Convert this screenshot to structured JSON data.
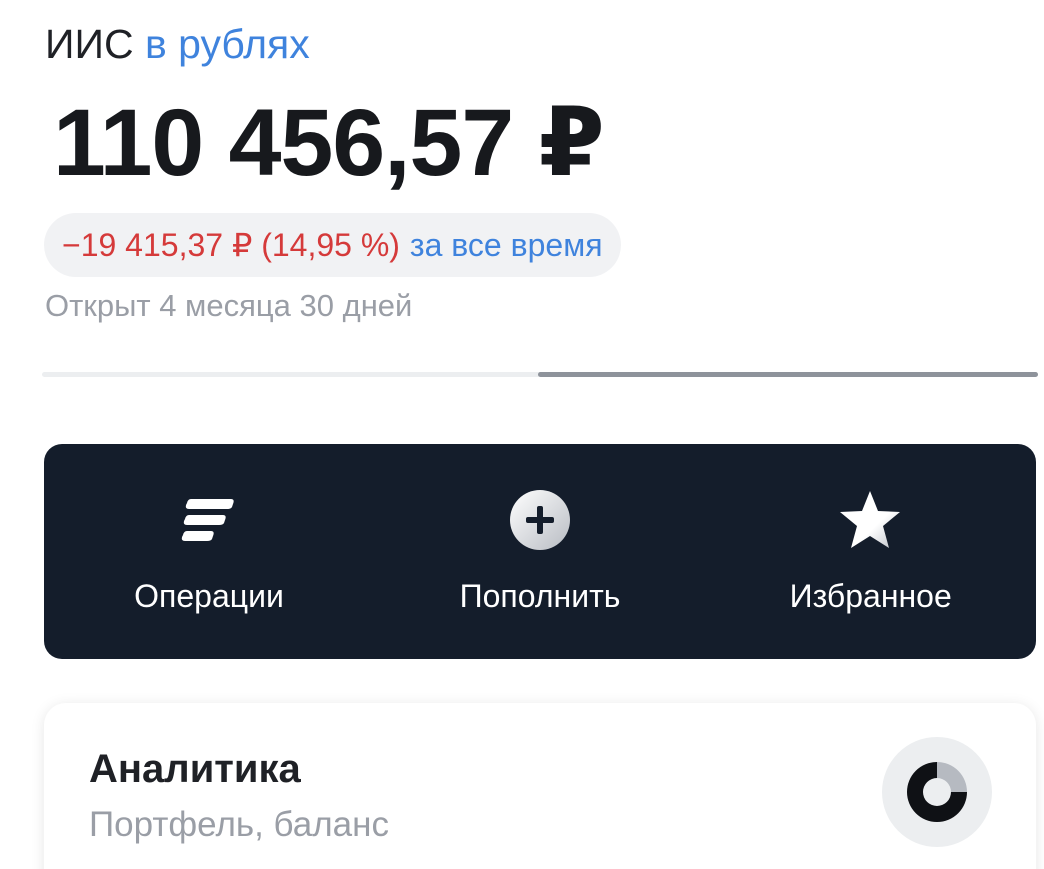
{
  "account": {
    "name": "ИИС",
    "currency_link": "в рублях"
  },
  "balance": "110 456,57 ₽",
  "pnl": {
    "change": "−19 415,37 ₽ (14,95 %)",
    "period": "за все время",
    "color": "#d53a3a"
  },
  "opened": "Открыт 4 месяца 30 дней",
  "scroll_progress": 0.5,
  "actions": [
    {
      "label": "Операции",
      "icon": "operations-icon"
    },
    {
      "label": "Пополнить",
      "icon": "plus-circle-icon"
    },
    {
      "label": "Избранное",
      "icon": "star-icon"
    }
  ],
  "analytics": {
    "title": "Аналитика",
    "subtitle": "Портфель, баланс",
    "icon": "donut-chart-icon"
  },
  "colors": {
    "accent": "#3f83dd",
    "dark_panel": "#141d2b",
    "negative": "#d53a3a"
  }
}
